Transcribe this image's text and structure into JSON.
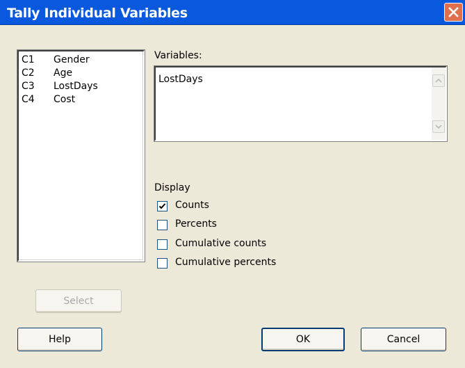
{
  "window": {
    "title": "Tally Individual Variables"
  },
  "columns": [
    {
      "id": "C1",
      "name": "Gender"
    },
    {
      "id": "C2",
      "name": "Age"
    },
    {
      "id": "C3",
      "name": "LostDays"
    },
    {
      "id": "C4",
      "name": "Cost"
    }
  ],
  "variables": {
    "label": "Variables:",
    "value": "LostDays"
  },
  "display": {
    "label": "Display",
    "options": [
      {
        "label": "Counts",
        "checked": true
      },
      {
        "label": "Percents",
        "checked": false
      },
      {
        "label": "Cumulative counts",
        "checked": false
      },
      {
        "label": "Cumulative percents",
        "checked": false
      }
    ]
  },
  "buttons": {
    "select": "Select",
    "help": "Help",
    "ok": "OK",
    "cancel": "Cancel"
  },
  "icons": {
    "close": "close-icon",
    "check": "checkmark-icon",
    "scroll_up": "chevron-up-icon",
    "scroll_down": "chevron-down-icon"
  }
}
